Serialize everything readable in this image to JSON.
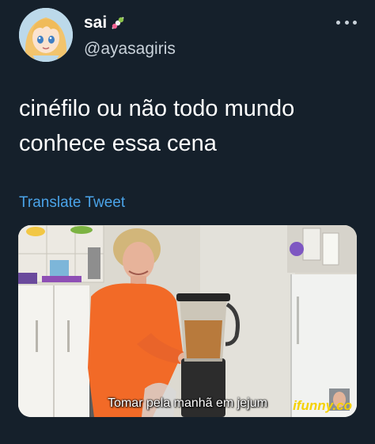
{
  "tweet": {
    "display_name": "sai",
    "name_emoji": "candy-icon",
    "handle": "@ayasagiris",
    "text_lines": [
      "cinéfilo ou não todo mundo",
      "conhece essa cena"
    ],
    "translate_label": "Translate Tweet",
    "more_icon": "more-horizontal-icon"
  },
  "media": {
    "subtitle": "Tomar pela manhã em jejum"
  },
  "watermark": "ifunny.co",
  "colors": {
    "background": "#15202b",
    "link": "#4aa3e8",
    "secondary_text": "#c9d2da",
    "watermark": "#f5d100"
  }
}
